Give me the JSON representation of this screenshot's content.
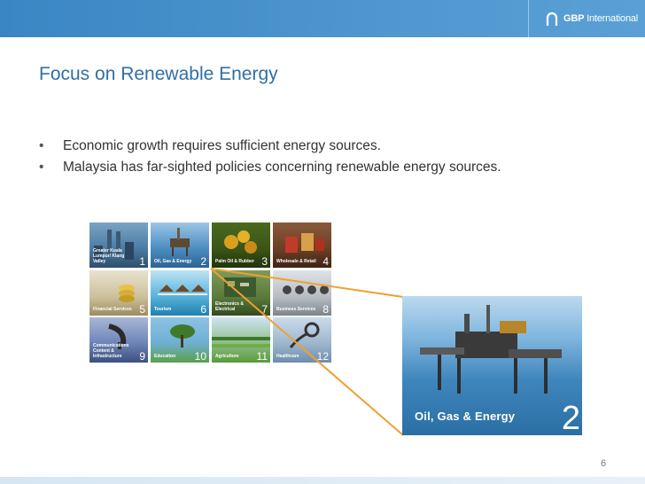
{
  "header": {
    "brand_name": "GBP",
    "brand_suffix": "International",
    "bar_color": "#4f97cf"
  },
  "slide": {
    "title": "Focus on Renewable Energy",
    "bullets": [
      "Economic growth requires sufficient energy sources.",
      "Malaysia has far-sighted policies concerning renewable energy sources."
    ],
    "page_number": "6"
  },
  "sectors": [
    {
      "label": "Greater Kuala Lumpur/ Klang Valley",
      "num": "1",
      "icon": "city-skyline-icon"
    },
    {
      "label": "Oil, Gas & Energy",
      "num": "2",
      "icon": "oil-rig-icon"
    },
    {
      "label": "Palm Oil & Rubber",
      "num": "3",
      "icon": "palm-fruit-icon"
    },
    {
      "label": "Wholesale & Retail",
      "num": "4",
      "icon": "shopping-bags-icon"
    },
    {
      "label": "Financial Services",
      "num": "5",
      "icon": "coins-icon"
    },
    {
      "label": "Tourism",
      "num": "6",
      "icon": "water-villa-icon"
    },
    {
      "label": "Electronics & Electrical",
      "num": "7",
      "icon": "circuit-board-icon"
    },
    {
      "label": "Business Services",
      "num": "8",
      "icon": "gears-icon"
    },
    {
      "label": "Communications Content & Infrastructure",
      "num": "9",
      "icon": "satellite-dish-icon"
    },
    {
      "label": "Education",
      "num": "10",
      "icon": "tree-icon"
    },
    {
      "label": "Agriculture",
      "num": "11",
      "icon": "field-icon"
    },
    {
      "label": "Healthcare",
      "num": "12",
      "icon": "stethoscope-icon"
    }
  ],
  "featured": {
    "label": "Oil, Gas & Energy",
    "num": "2"
  },
  "colors": {
    "title": "#2f6fa6",
    "connector": "#f0a030"
  }
}
